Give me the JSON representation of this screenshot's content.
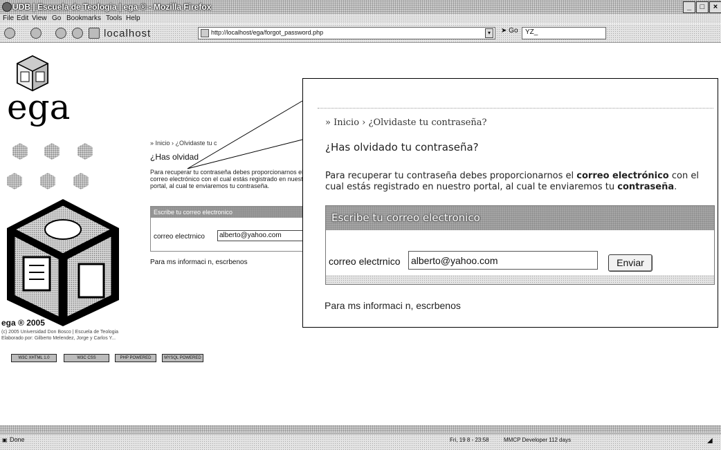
{
  "window": {
    "title": "UDB | Escuela de Teologia | ega ® - Mozilla Firefox",
    "controls": [
      "_",
      "□",
      "×"
    ]
  },
  "menu": {
    "items": [
      "File",
      "Edit",
      "View",
      "Go",
      "Bookmarks",
      "Tools",
      "Help"
    ]
  },
  "navbar": {
    "host_label": "localhost",
    "url": "http://localhost/ega/forgot_password.php",
    "go_label": "Go",
    "search_value": "YZ_"
  },
  "logo": {
    "text": "ega"
  },
  "sidebar": {
    "copyright_title": "ega ® 2005",
    "copyright_line1": "(c) 2005 Universidad Don Bosco | Escuela de Teologia",
    "copyright_line2": "Elaborado por: Gilberto Melendez, Jorge y Carlos Y...",
    "badges": [
      "W3C XHTML 1.0",
      "W3C CSS",
      "PHP POWERED",
      "MYSQL POWERED"
    ]
  },
  "small_view": {
    "crumb": "» Inicio › ¿Olvidaste tu c",
    "heading": "¿Has olvidad",
    "para": "Para recuperar tu contraseña debes proporcionarnos el correo electrónico con el cual estás registrado en nuestro portal, al cual te enviaremos tu contraseña.",
    "form_header": "Escribe tu correo electronico",
    "label": "correo electrnico",
    "input_value": "alberto@yahoo.com",
    "footer": "Para ms informaci n, escrbenos"
  },
  "callout": {
    "crumb_home": "» Inicio",
    "crumb_sep": "›",
    "crumb_current": "¿Olvidaste tu contraseña?",
    "heading": "¿Has olvidado tu contraseña?",
    "para_part1": "Para recuperar tu contraseña debes proporcionarnos el ",
    "para_bold1": "correo electrónico",
    "para_part2": " con el cual estás registrado en nuestro portal, al cual te enviaremos tu ",
    "para_bold2": "contraseña",
    "para_part3": ".",
    "form_header": "Escribe tu correo electronico",
    "label": "correo electrnico",
    "input_value": "alberto@yahoo.com",
    "button_label": "Enviar",
    "footer": "Para ms informaci n, escrbenos"
  },
  "statusbar": {
    "status": "Done",
    "date": "Fri, 19 8 - 23:58",
    "info": "MMCP Developer 112 days"
  }
}
